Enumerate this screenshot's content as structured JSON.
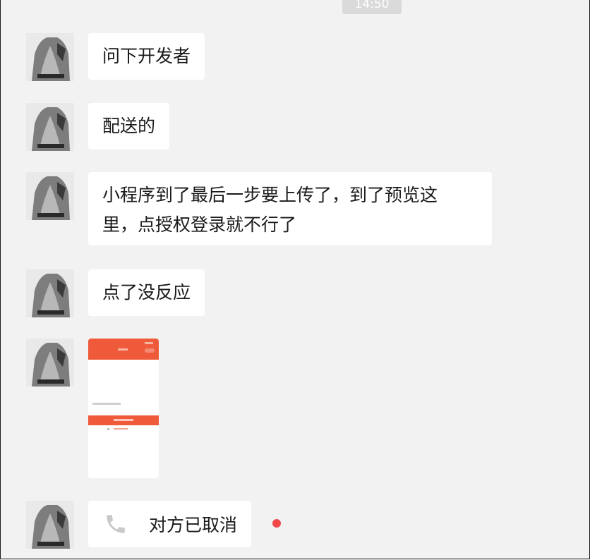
{
  "chat": {
    "timestamp": "14:50",
    "messages": [
      {
        "type": "text",
        "text": "问下开发者"
      },
      {
        "type": "text",
        "text": "配送的"
      },
      {
        "type": "text",
        "lines": [
          "小程序到了最后一步要上传了，到了预览这",
          "里，点授权登录就不行了"
        ]
      },
      {
        "type": "text",
        "text": "点了没反应"
      },
      {
        "type": "image"
      },
      {
        "type": "call",
        "text": "对方已取消",
        "icon": "phone-icon",
        "unread": true
      }
    ]
  },
  "colors": {
    "background": "#f2f2f2",
    "bubble": "#ffffff",
    "accent": "#ef5b3a",
    "unread_dot": "#f04848",
    "call_icon": "#c9c9c9"
  }
}
